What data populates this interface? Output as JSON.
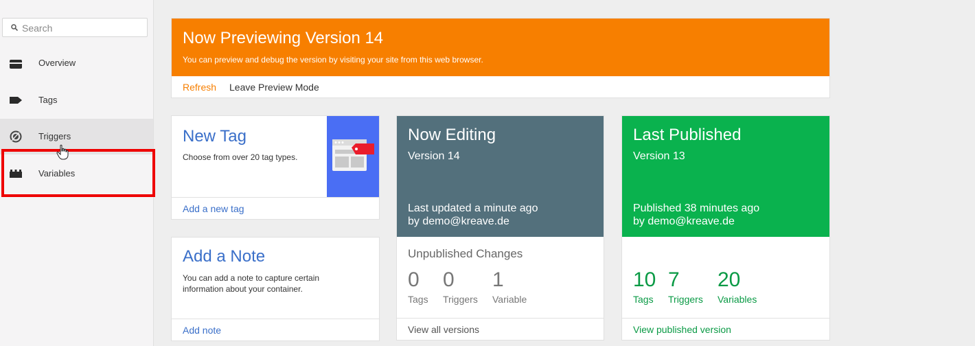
{
  "sidebar": {
    "search_placeholder": "Search",
    "items": [
      {
        "label": "Overview",
        "icon": "briefcase-icon"
      },
      {
        "label": "Tags",
        "icon": "tag-icon"
      },
      {
        "label": "Triggers",
        "icon": "trigger-icon"
      },
      {
        "label": "Variables",
        "icon": "blocks-icon"
      }
    ]
  },
  "banner": {
    "title": "Now Previewing Version 14",
    "subtitle": "You can preview and debug the version by visiting your site from this web browser.",
    "refresh": "Refresh",
    "leave": "Leave Preview Mode",
    "color": "#f77f00"
  },
  "new_tag": {
    "title": "New Tag",
    "text": "Choose from over 20 tag types.",
    "link": "Add a new tag"
  },
  "note": {
    "title": "Add a Note",
    "text": "You can add a note to capture certain information about your container.",
    "link": "Add note"
  },
  "editing": {
    "title": "Now Editing",
    "version": "Version 14",
    "updated_line1": "Last updated a minute ago",
    "updated_line2": "by demo@kreave.de",
    "changes_label": "Unpublished Changes",
    "stats": [
      {
        "num": "0",
        "label": "Tags"
      },
      {
        "num": "0",
        "label": "Triggers"
      },
      {
        "num": "1",
        "label": "Variable"
      }
    ],
    "link": "View all versions",
    "color": "#53707c"
  },
  "published": {
    "title": "Last Published",
    "version": "Version 13",
    "updated_line1": "Published 38 minutes ago",
    "updated_line2": "by demo@kreave.de",
    "stats": [
      {
        "num": "10",
        "label": "Tags"
      },
      {
        "num": "7",
        "label": "Triggers"
      },
      {
        "num": "20",
        "label": "Variables"
      }
    ],
    "link": "View published version",
    "color": "#0ab24e"
  }
}
